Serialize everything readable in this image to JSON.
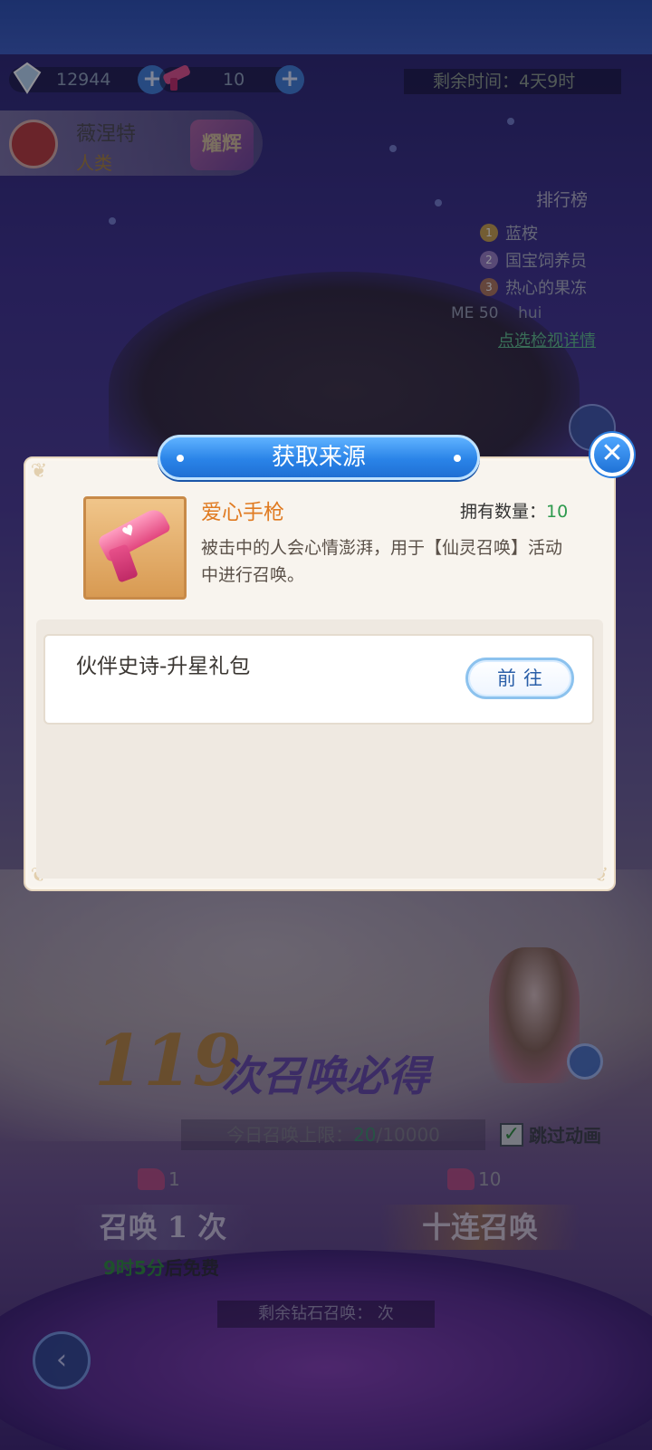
{
  "currency": {
    "diamond_amount": "12944",
    "gun_amount": "10"
  },
  "event": {
    "time_label": "剩余时间：",
    "time_value": "4天9时"
  },
  "character": {
    "name": "薇涅特",
    "race": "人类",
    "rank_badge": "耀辉"
  },
  "ranking": {
    "title": "排行榜",
    "entries": [
      {
        "rank": "1",
        "name": "蓝桉",
        "color": "#c9a04a"
      },
      {
        "rank": "2",
        "name": "国宝饲养员",
        "color": "#9a7ec4"
      },
      {
        "rank": "3",
        "name": "热心的果冻",
        "color": "#b0775a"
      }
    ],
    "me_label": "ME 50",
    "me_name": "hui",
    "detail_link": "点选检视详情"
  },
  "modal": {
    "title": "获取来源",
    "item_name": "爱心手枪",
    "own_label": "拥有数量：",
    "own_value": "10",
    "description": "被击中的人会心情澎湃，用于【仙灵召唤】活动中进行召唤。",
    "sources": [
      {
        "name": "伙伴史诗-升星礼包",
        "button": "前往"
      }
    ]
  },
  "summon": {
    "guarantee_count": "119",
    "guarantee_text": "次召唤必得",
    "limit_label": "今日召唤上限：",
    "limit_used": "20",
    "limit_total": "/10000",
    "skip_label": "跳过动画",
    "skip_checked": true,
    "one_cost": "1",
    "ten_cost": "10",
    "one_label": "召唤 1 次",
    "ten_label": "十连召唤",
    "free_time": "9时5分",
    "free_suffix": "后免费",
    "diamond_summon_label": "剩余钻石召唤：",
    "diamond_summon_count": "",
    "diamond_summon_unit": "次"
  }
}
